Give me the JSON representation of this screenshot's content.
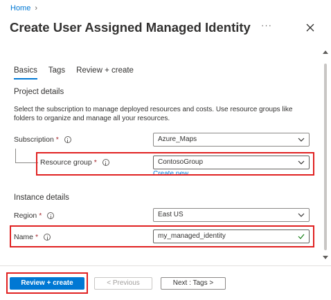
{
  "breadcrumb": {
    "home": "Home"
  },
  "header": {
    "title": "Create User Assigned Managed Identity",
    "more": "···"
  },
  "tabs": [
    {
      "label": "Basics",
      "active": true
    },
    {
      "label": "Tags",
      "active": false
    },
    {
      "label": "Review + create",
      "active": false
    }
  ],
  "project": {
    "title": "Project details",
    "description": "Select the subscription to manage deployed resources and costs. Use resource groups like folders to organize and manage all your resources."
  },
  "subscription": {
    "label": "Subscription",
    "required": "*",
    "value": "Azure_Maps"
  },
  "resource_group": {
    "label": "Resource group",
    "required": "*",
    "value": "ContosoGroup",
    "create_new": "Create new"
  },
  "instance": {
    "title": "Instance details"
  },
  "region": {
    "label": "Region",
    "required": "*",
    "value": "East US"
  },
  "name": {
    "label": "Name",
    "required": "*",
    "value": "my_managed_identity"
  },
  "footer": {
    "review_create": "Review + create",
    "previous": "< Previous",
    "next": "Next : Tags >"
  },
  "colors": {
    "accent": "#0078d4",
    "highlight": "#e02020",
    "required": "#a4262c",
    "valid": "#107c10"
  }
}
